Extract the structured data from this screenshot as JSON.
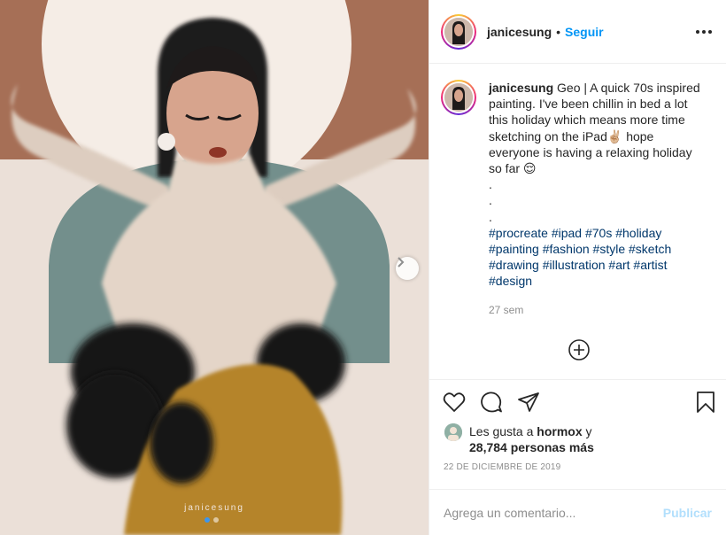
{
  "post": {
    "username": "janicesung",
    "follow_label": "Seguir",
    "bullet": "•",
    "caption_text": "Geo | A quick 70s inspired painting. I've been chillin in bed a lot this holiday which means more time sketching on the iPad✌🏼 hope everyone is having a relaxing holiday so far 😌",
    "caption_dots": [
      ".",
      ".",
      "."
    ],
    "hashtags": "#procreate #ipad #70s #holiday #painting #fashion #style #sketch #drawing #illustration #art #artist #design",
    "time_ago": "27 sem",
    "likes_prefix": "Les gusta a ",
    "likes_user": "hormox",
    "likes_suffix": " y",
    "likes_count": "28,784 personas más",
    "date": "22 DE DICIEMBRE DE 2019",
    "comment_placeholder": "Agrega un comentario...",
    "publish_label": "Publicar",
    "watermark": "janicesung",
    "carousel": {
      "total": 2,
      "current": 1
    }
  },
  "icons": {
    "more": "more-options-icon",
    "like": "heart-icon",
    "comment": "comment-icon",
    "share": "share-icon",
    "save": "bookmark-icon",
    "add": "add-circle-icon",
    "next": "chevron-right-icon"
  },
  "colors": {
    "follow": "#0095f6",
    "hashtag": "#00376b",
    "publish_disabled": "#b2dffc",
    "secondary_text": "#8e8e8e"
  }
}
